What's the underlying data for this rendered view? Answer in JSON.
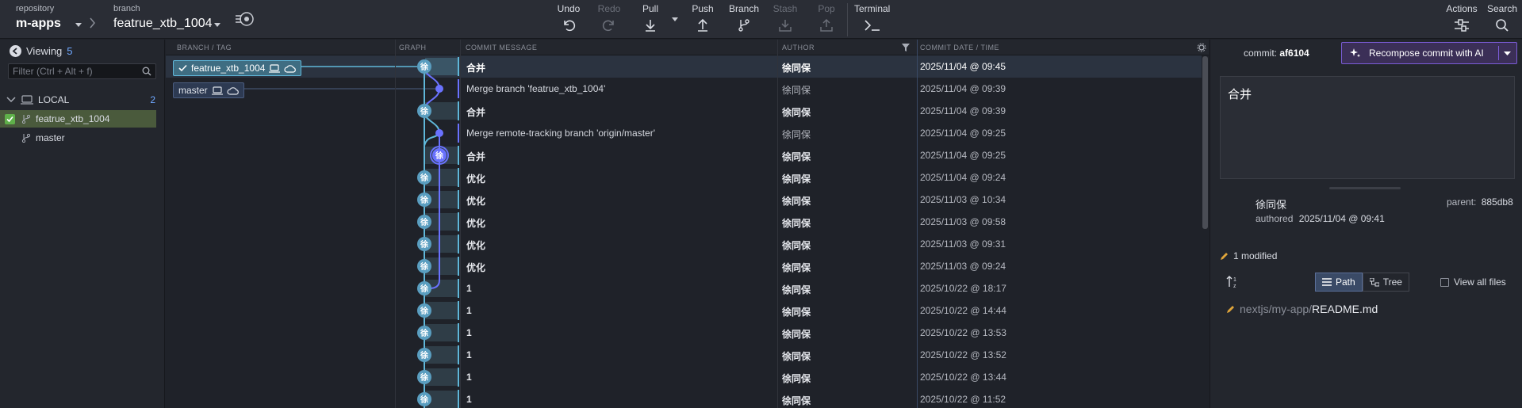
{
  "toolbar": {
    "repository_label": "repository",
    "repository_name": "m-apps",
    "branch_label": "branch",
    "branch_name": "featrue_xtb_1004",
    "actions": {
      "undo": "Undo",
      "redo": "Redo",
      "pull": "Pull",
      "push": "Push",
      "branch": "Branch",
      "stash": "Stash",
      "pop": "Pop",
      "terminal": "Terminal",
      "actions_menu": "Actions",
      "search": "Search"
    }
  },
  "sidebar": {
    "viewing_label": "Viewing",
    "viewing_count": "5",
    "filter_placeholder": "Filter (Ctrl + Alt + f)",
    "local_label": "LOCAL",
    "local_count": "2",
    "branches": [
      {
        "name": "featrue_xtb_1004",
        "checked_out": true
      },
      {
        "name": "master",
        "checked_out": false
      }
    ]
  },
  "graph": {
    "columns": {
      "branch_tag": "BRANCH / TAG",
      "graph": "GRAPH",
      "message": "COMMIT MESSAGE",
      "author": "AUTHOR",
      "date": "COMMIT DATE / TIME"
    },
    "tags": {
      "head": "featrue_xtb_1004",
      "other": "master"
    },
    "avatar_glyph": "徐",
    "commits": [
      {
        "message": "合并",
        "author": "徐同保",
        "date": "2025/11/04 @ 09:45",
        "merge": false
      },
      {
        "message": "Merge branch 'featrue_xtb_1004'",
        "author": "徐同保",
        "date": "2025/11/04 @ 09:39",
        "merge": true
      },
      {
        "message": "合并",
        "author": "徐同保",
        "date": "2025/11/04 @ 09:39",
        "merge": false
      },
      {
        "message": "Merge remote-tracking branch 'origin/master'",
        "author": "徐同保",
        "date": "2025/11/04 @ 09:25",
        "merge": true
      },
      {
        "message": "合并",
        "author": "徐同保",
        "date": "2025/11/04 @ 09:25",
        "merge": false
      },
      {
        "message": "优化",
        "author": "徐同保",
        "date": "2025/11/04 @ 09:24",
        "merge": false
      },
      {
        "message": "优化",
        "author": "徐同保",
        "date": "2025/11/03 @ 10:34",
        "merge": false
      },
      {
        "message": "优化",
        "author": "徐同保",
        "date": "2025/11/03 @ 09:58",
        "merge": false
      },
      {
        "message": "优化",
        "author": "徐同保",
        "date": "2025/11/03 @ 09:31",
        "merge": false
      },
      {
        "message": "优化",
        "author": "徐同保",
        "date": "2025/11/03 @ 09:24",
        "merge": false
      },
      {
        "message": "1",
        "author": "徐同保",
        "date": "2025/10/22 @ 18:17",
        "merge": false
      },
      {
        "message": "1",
        "author": "徐同保",
        "date": "2025/10/22 @ 14:44",
        "merge": false
      },
      {
        "message": "1",
        "author": "徐同保",
        "date": "2025/10/22 @ 13:53",
        "merge": false
      },
      {
        "message": "1",
        "author": "徐同保",
        "date": "2025/10/22 @ 13:52",
        "merge": false
      },
      {
        "message": "1",
        "author": "徐同保",
        "date": "2025/10/22 @ 13:44",
        "merge": false
      },
      {
        "message": "1",
        "author": "徐同保",
        "date": "2025/10/22 @ 11:52",
        "merge": false
      }
    ]
  },
  "detail": {
    "commit_label": "commit:",
    "commit_sha": "af6104",
    "ai_button_label": "Recompose commit with AI",
    "message": "合并",
    "author_name": "徐同保",
    "authored_label": "authored",
    "authored_date": "2025/11/04 @ 09:41",
    "parent_label": "parent:",
    "parent_sha": "885db8",
    "modified_summary": "1 modified",
    "view_path_label": "Path",
    "view_tree_label": "Tree",
    "view_all_label": "View all files",
    "file_dir": "nextjs/my-app/",
    "file_name": "README.md"
  },
  "colors": {
    "head_branch": "#5fb7d9",
    "merge_lane": "#6a72ff",
    "ai_accent": "#7a5cd6",
    "checked_green": "#5fb04a"
  }
}
